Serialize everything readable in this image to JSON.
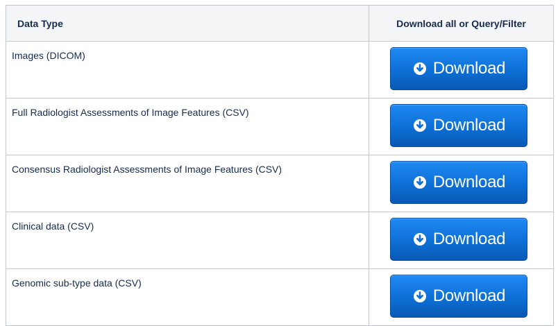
{
  "table": {
    "headers": {
      "data_type": "Data Type",
      "download": "Download all or Query/Filter"
    },
    "rows": [
      {
        "data_type": "Images (DICOM)",
        "button_label": "Download"
      },
      {
        "data_type": "Full Radiologist Assessments of Image Features  (CSV)",
        "button_label": "Download"
      },
      {
        "data_type": "Consensus Radiologist Assessments of Image Features  (CSV)",
        "button_label": "Download"
      },
      {
        "data_type": "Clinical data (CSV)",
        "button_label": "Download"
      },
      {
        "data_type": "Genomic sub-type data (CSV)",
        "button_label": "Download"
      }
    ]
  },
  "colors": {
    "button_blue": "#0d6fd6",
    "header_bg": "#f4f5f7",
    "border": "#c1c7d0"
  },
  "icons": {
    "download": "circle-arrow-down-icon"
  }
}
